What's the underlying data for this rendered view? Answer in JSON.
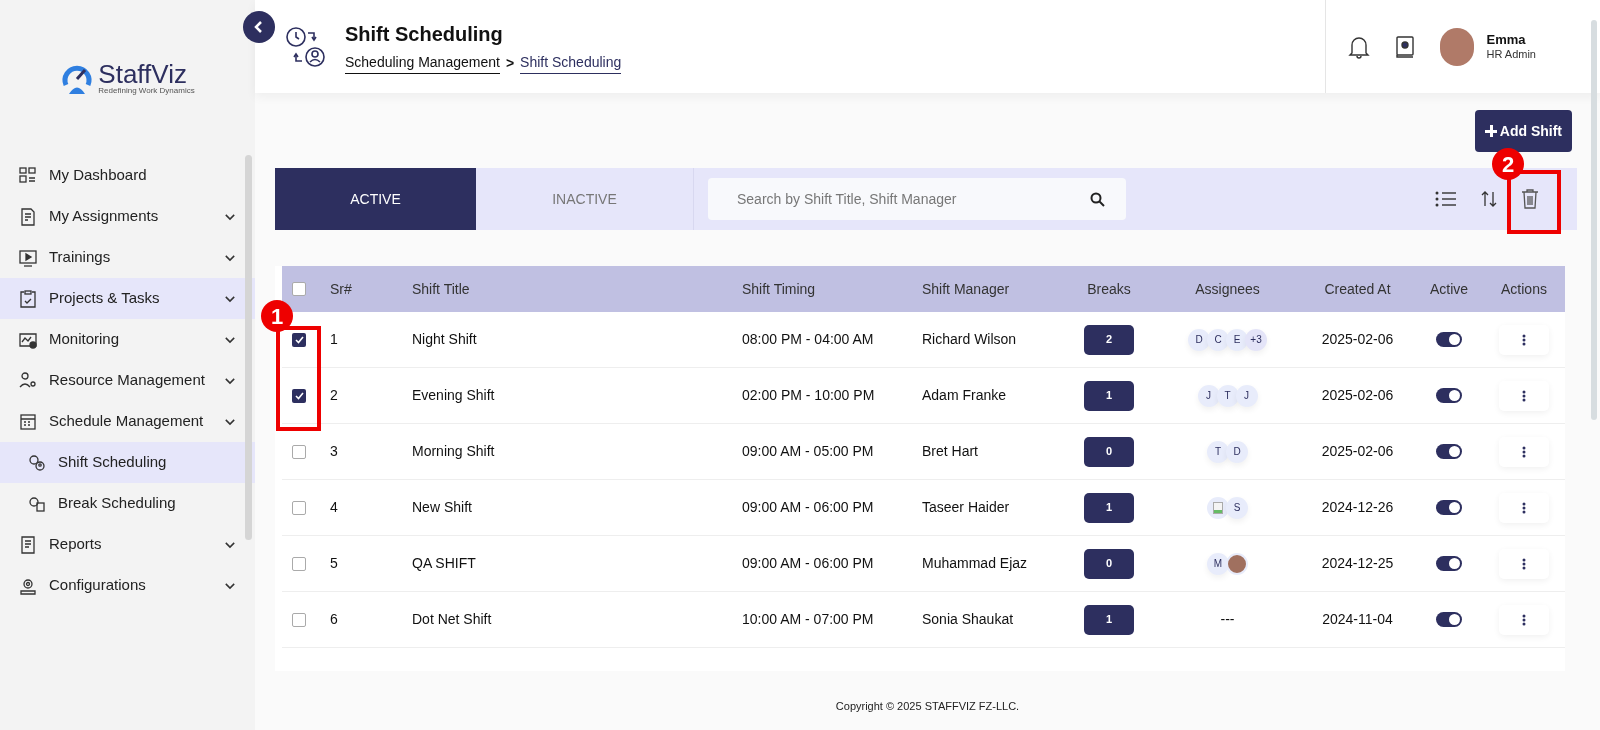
{
  "logo": {
    "name": "StaffViz",
    "tagline": "Redefining Work Dynamics"
  },
  "sidebar": {
    "items": [
      {
        "label": "My Dashboard",
        "kind": "link",
        "selected": false
      },
      {
        "label": "My Assignments",
        "kind": "menu",
        "selected": false
      },
      {
        "label": "Trainings",
        "kind": "menu",
        "selected": false
      },
      {
        "label": "Projects & Tasks",
        "kind": "menu",
        "selected": true
      },
      {
        "label": "Monitoring",
        "kind": "menu",
        "selected": false
      },
      {
        "label": "Resource Management",
        "kind": "menu",
        "selected": false
      },
      {
        "label": "Schedule Management",
        "kind": "menu",
        "selected": false,
        "children": [
          {
            "label": "Shift Scheduling",
            "selected": true
          },
          {
            "label": "Break Scheduling",
            "selected": false
          }
        ]
      },
      {
        "label": "Reports",
        "kind": "menu",
        "selected": false
      },
      {
        "label": "Configurations",
        "kind": "menu",
        "selected": false
      }
    ]
  },
  "header": {
    "title": "Shift Scheduling",
    "breadcrumb": [
      "Scheduling Management",
      "Shift Scheduling"
    ],
    "separator": ">",
    "user": {
      "name": "Emma",
      "role": "HR Admin"
    }
  },
  "add_button": "Add Shift",
  "tabs": [
    {
      "label": "ACTIVE",
      "selected": true
    },
    {
      "label": "INACTIVE",
      "selected": false
    }
  ],
  "search": {
    "placeholder": "Search by Shift Title, Shift Manager"
  },
  "table": {
    "columns": [
      "Sr#",
      "Shift Title",
      "Shift Timing",
      "Shift Manager",
      "Breaks",
      "Assignees",
      "Created At",
      "Active",
      "Actions"
    ],
    "all_checked": false,
    "rows": [
      {
        "checked": true,
        "sr": "1",
        "title": "Night Shift",
        "timing": "08:00 PM - 04:00 AM",
        "manager": "Richard Wilson",
        "breaks": "2",
        "assignees": [
          {
            "kind": "initial",
            "text": "D"
          },
          {
            "kind": "initial",
            "text": "C"
          },
          {
            "kind": "initial",
            "text": "E"
          },
          {
            "kind": "more",
            "text": "+3"
          }
        ],
        "created": "2025-02-06",
        "active": true
      },
      {
        "checked": true,
        "sr": "2",
        "title": "Evening Shift",
        "timing": "02:00 PM - 10:00 PM",
        "manager": "Adam Franke",
        "breaks": "1",
        "assignees": [
          {
            "kind": "initial",
            "text": "J"
          },
          {
            "kind": "initial",
            "text": "T"
          },
          {
            "kind": "initial",
            "text": "J"
          }
        ],
        "created": "2025-02-06",
        "active": true
      },
      {
        "checked": false,
        "sr": "3",
        "title": "Morning Shift",
        "timing": "09:00 AM - 05:00 PM",
        "manager": "Bret Hart",
        "breaks": "0",
        "assignees": [
          {
            "kind": "initial",
            "text": "T"
          },
          {
            "kind": "initial",
            "text": "D"
          }
        ],
        "created": "2025-02-06",
        "active": true
      },
      {
        "checked": false,
        "sr": "4",
        "title": "New Shift",
        "timing": "09:00 AM - 06:00 PM",
        "manager": "Taseer Haider",
        "breaks": "1",
        "assignees": [
          {
            "kind": "image"
          },
          {
            "kind": "initial",
            "text": "S"
          }
        ],
        "created": "2024-12-26",
        "active": true
      },
      {
        "checked": false,
        "sr": "5",
        "title": "QA SHIFT",
        "timing": "09:00 AM - 06:00 PM",
        "manager": "Muhammad Ejaz",
        "breaks": "0",
        "assignees": [
          {
            "kind": "initial",
            "text": "M"
          },
          {
            "kind": "photo"
          }
        ],
        "created": "2024-12-25",
        "active": true
      },
      {
        "checked": false,
        "sr": "6",
        "title": "Dot Net Shift",
        "timing": "10:00 AM - 07:00 PM",
        "manager": "Sonia Shaukat",
        "breaks": "1",
        "assignees_text": "---",
        "created": "2024-11-04",
        "active": true
      }
    ]
  },
  "annotations": [
    {
      "label": "1"
    },
    {
      "label": "2"
    }
  ],
  "footer": "Copyright © 2025 STAFFVIZ FZ-LLC."
}
